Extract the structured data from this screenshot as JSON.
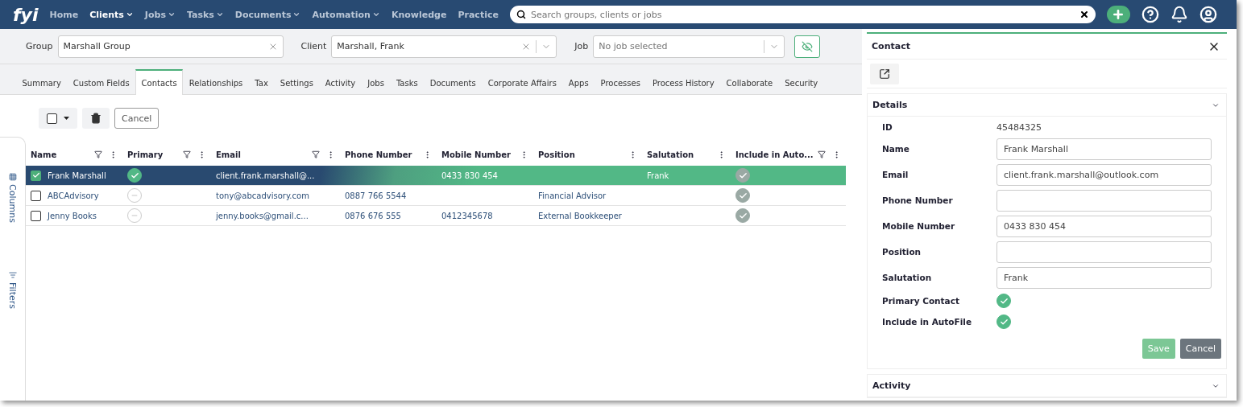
{
  "nav": {
    "logo": "fyi",
    "items": [
      {
        "label": "Home",
        "dropdown": false,
        "selected": false
      },
      {
        "label": "Clients",
        "dropdown": true,
        "selected": true
      },
      {
        "label": "Jobs",
        "dropdown": true,
        "selected": false
      },
      {
        "label": "Tasks",
        "dropdown": true,
        "selected": false
      },
      {
        "label": "Documents",
        "dropdown": true,
        "selected": false
      },
      {
        "label": "Automation",
        "dropdown": true,
        "selected": false
      },
      {
        "label": "Knowledge",
        "dropdown": false,
        "selected": false
      },
      {
        "label": "Practice",
        "dropdown": false,
        "selected": false
      }
    ],
    "search": {
      "placeholder": "Search groups, clients or jobs"
    }
  },
  "selectors": {
    "group": {
      "label": "Group",
      "value": "Marshall Group"
    },
    "client": {
      "label": "Client",
      "value": "Marshall, Frank"
    },
    "job": {
      "label": "Job",
      "placeholder": "No job selected"
    }
  },
  "tabs": [
    {
      "label": "Summary",
      "selected": false
    },
    {
      "label": "Custom Fields",
      "selected": false
    },
    {
      "label": "Contacts",
      "selected": true
    },
    {
      "label": "Relationships",
      "selected": false
    },
    {
      "label": "Tax",
      "selected": false
    },
    {
      "label": "Settings",
      "selected": false
    },
    {
      "label": "Activity",
      "selected": false
    },
    {
      "label": "Jobs",
      "selected": false
    },
    {
      "label": "Tasks",
      "selected": false
    },
    {
      "label": "Documents",
      "selected": false
    },
    {
      "label": "Corporate Affairs",
      "selected": false
    },
    {
      "label": "Apps",
      "selected": false
    },
    {
      "label": "Processes",
      "selected": false
    },
    {
      "label": "Process History",
      "selected": false
    },
    {
      "label": "Collaborate",
      "selected": false
    },
    {
      "label": "Security",
      "selected": false
    }
  ],
  "toolbar": {
    "cancel": "Cancel"
  },
  "side_tabs": [
    "Columns",
    "Filters"
  ],
  "table": {
    "columns": [
      {
        "label": "Name",
        "filter": true
      },
      {
        "label": "Primary",
        "filter": true
      },
      {
        "label": "Email",
        "filter": true
      },
      {
        "label": "Phone Number",
        "filter": false
      },
      {
        "label": "Mobile Number",
        "filter": false
      },
      {
        "label": "Position",
        "filter": false
      },
      {
        "label": "Salutation",
        "filter": false
      },
      {
        "label": "Include in Auto...",
        "filter": true
      }
    ],
    "rows": [
      {
        "selected": true,
        "name": "Frank Marshall",
        "primary": true,
        "email": "client.frank.marshall@...",
        "phone": "",
        "mobile": "0433 830 454",
        "position": "",
        "salutation": "Frank",
        "autofile": true
      },
      {
        "selected": false,
        "name": "ABCAdvisory",
        "primary": false,
        "email": "tony@abcadvisory.com",
        "phone": "0887 766 5544",
        "mobile": "",
        "position": "Financial Advisor",
        "salutation": "",
        "autofile": true
      },
      {
        "selected": false,
        "name": "Jenny Books",
        "primary": false,
        "email": "jenny.books@gmail.c...",
        "phone": "0876 676 555",
        "mobile": "0412345678",
        "position": "External Bookkeeper",
        "salutation": "",
        "autofile": true
      }
    ]
  },
  "panel": {
    "title": "Contact",
    "details": {
      "title": "Details",
      "id_label": "ID",
      "id_value": "45484325",
      "fields": [
        {
          "label": "Name",
          "value": "Frank Marshall"
        },
        {
          "label": "Email",
          "value": "client.frank.marshall@outlook.com"
        },
        {
          "label": "Phone Number"
        },
        {
          "label": "Mobile Number",
          "value": "0433 830 454"
        },
        {
          "label": "Position"
        },
        {
          "label": "Salutation",
          "value": "Frank"
        }
      ],
      "toggles": [
        {
          "label": "Primary Contact",
          "checked": true
        },
        {
          "label": "Include in AutoFile",
          "checked": true
        }
      ],
      "save": "Save",
      "cancel": "Cancel"
    },
    "activity": {
      "title": "Activity"
    }
  }
}
